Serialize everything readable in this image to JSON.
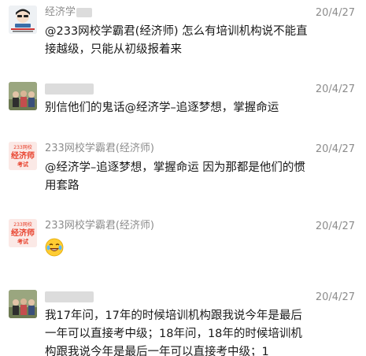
{
  "comments": [
    {
      "name": "经济学",
      "date": "20/4/27",
      "text": "@233网校学霸君(经济师) 怎么有培训机构说不能直接越级，只能从初级报着来",
      "avatar": "cartoon-avatar"
    },
    {
      "name": "",
      "date": "20/4/27",
      "text": "别信他们的鬼话@经济学–追逐梦想，掌握命运",
      "avatar": "photo-avatar"
    },
    {
      "name": "233网校学霸君(经济师)",
      "date": "20/4/27",
      "text": "@经济学–追逐梦想，掌握命运 因为那都是他们的惯用套路",
      "avatar": "brand-logo-avatar",
      "logo_top": "233网校",
      "logo_main": "经济师",
      "logo_sub": "考试"
    },
    {
      "name": "233网校学霸君(经济师)",
      "date": "20/4/27",
      "text": "",
      "emoji": "laugh-cry-emoji",
      "avatar": "brand-logo-avatar",
      "logo_top": "233网校",
      "logo_main": "经济师",
      "logo_sub": "考试"
    },
    {
      "name": "",
      "date": "20/4/27",
      "text": "我17年问，17年的时候培训机构跟我说今年是最后一年可以直接考中级；18年问，18年的时候培训机构跟我说今年是最后一年可以直接考中级；1",
      "avatar": "photo-avatar"
    }
  ],
  "colors": {
    "name": "#8c8c8c",
    "text": "#191919",
    "logo_red": "#e8412c"
  }
}
